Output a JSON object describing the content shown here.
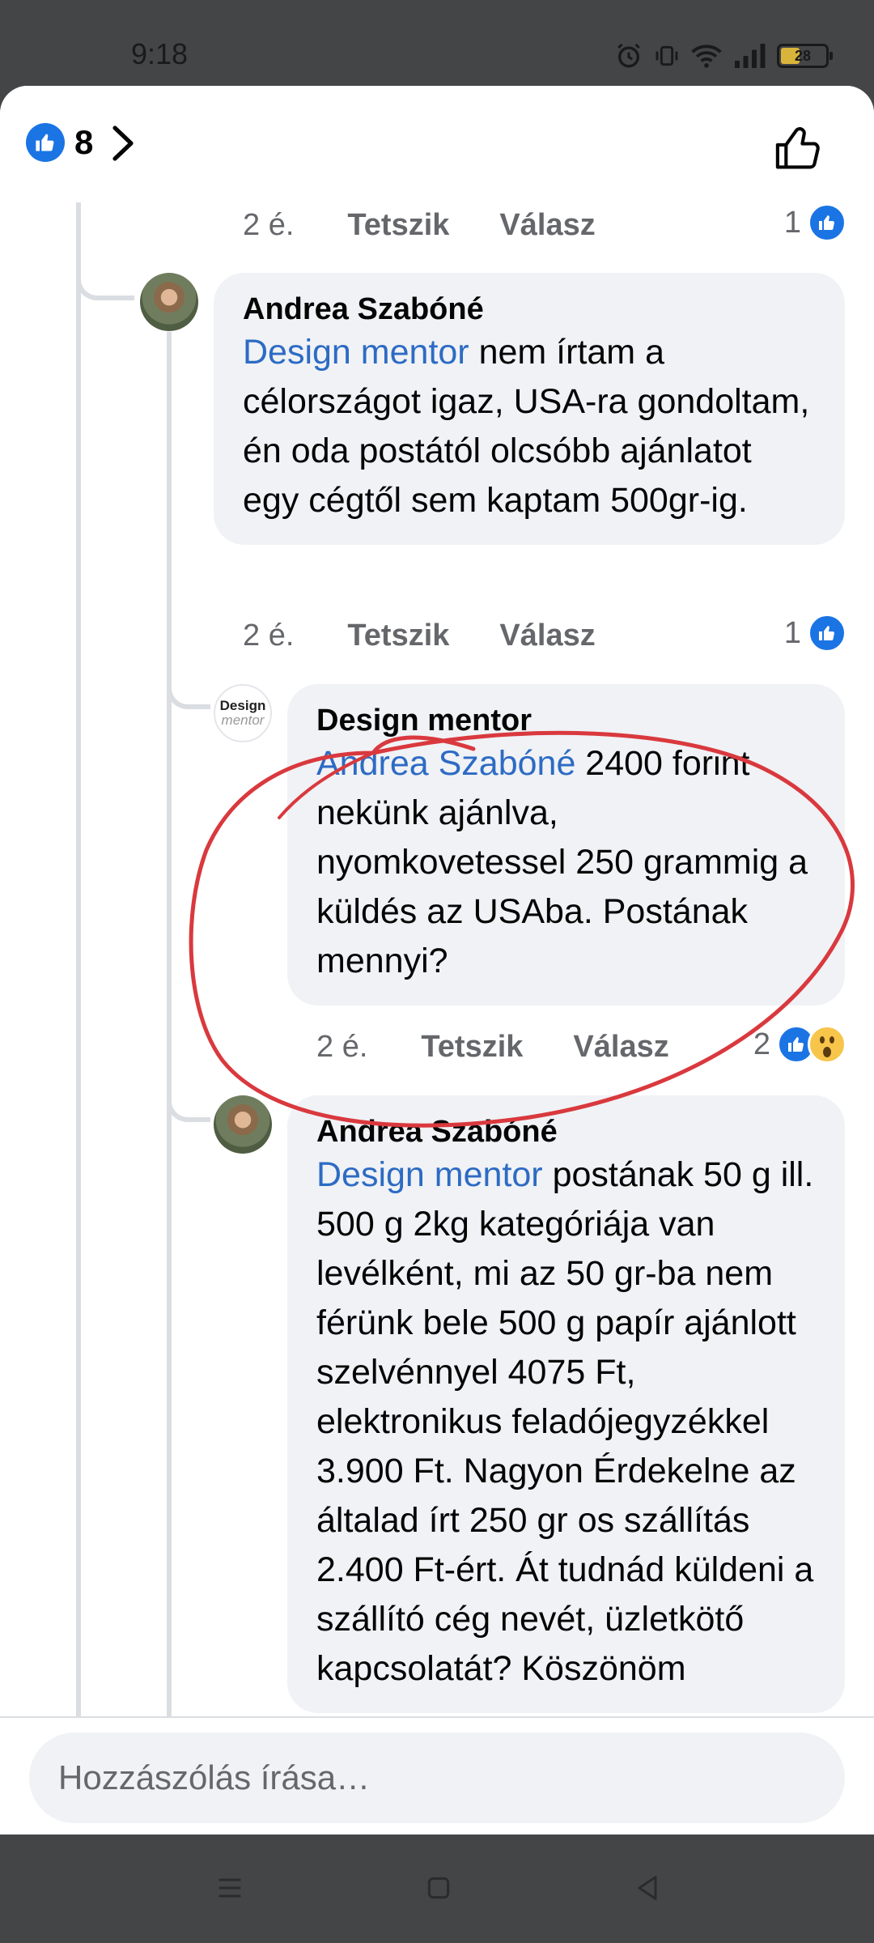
{
  "status_bar": {
    "time": "9:18",
    "battery": "28"
  },
  "header": {
    "reaction_count": "8"
  },
  "comments": [
    {
      "time": "2 é.",
      "like": "Tetszik",
      "reply": "Válasz",
      "reaction_count": "1"
    },
    {
      "author": "Andrea Szabóné",
      "mention": "Design mentor",
      "text": " nem írtam a célországot igaz, USA-ra gondoltam, én oda postától olcsóbb ajánlatot egy cégtől sem kaptam 500gr-ig.",
      "time": "2 é.",
      "like": "Tetszik",
      "reply": "Válasz",
      "reaction_count": "1"
    },
    {
      "author": "Design mentor",
      "avatar_line1": "Design",
      "avatar_line2": "mentor",
      "mention": "Andrea Szabóné",
      "text": " 2400 forint nekünk ajánlva, nyomkovetessel 250 grammig a küldés az USAba. Postának mennyi?",
      "time": "2 é.",
      "like": "Tetszik",
      "reply": "Válasz",
      "reaction_count": "2"
    },
    {
      "author": "Andrea Szabóné",
      "mention": "Design mentor",
      "text": " postának 50 g ill. 500 g 2kg kategóriája van levélként, mi az 50 gr-ba nem férünk bele 500 g papír ajánlott szelvénnyel 4075 Ft, elektronikus feladójegyzékkel 3.900 Ft. Nagyon Érdekelne az általad írt 250 gr os szállítás 2.400 Ft-ért. Át tudnád küldeni a szállító cég nevét, üzletkötő kapcsolatát? Köszönöm"
    }
  ],
  "composer": {
    "placeholder": "Hozzászólás írása…"
  },
  "colors": {
    "accent": "#1b74e4",
    "mention": "#2d6bc4",
    "annotation": "#d9393e",
    "bubble": "#f0f2f5"
  },
  "icons": [
    "like-icon",
    "chevron-right-icon",
    "thumbs-up-outline-icon",
    "wow-icon",
    "menu-icon",
    "home-icon",
    "back-icon",
    "alarm-icon",
    "vibrate-icon",
    "wifi-icon",
    "signal-icon",
    "battery-icon"
  ]
}
